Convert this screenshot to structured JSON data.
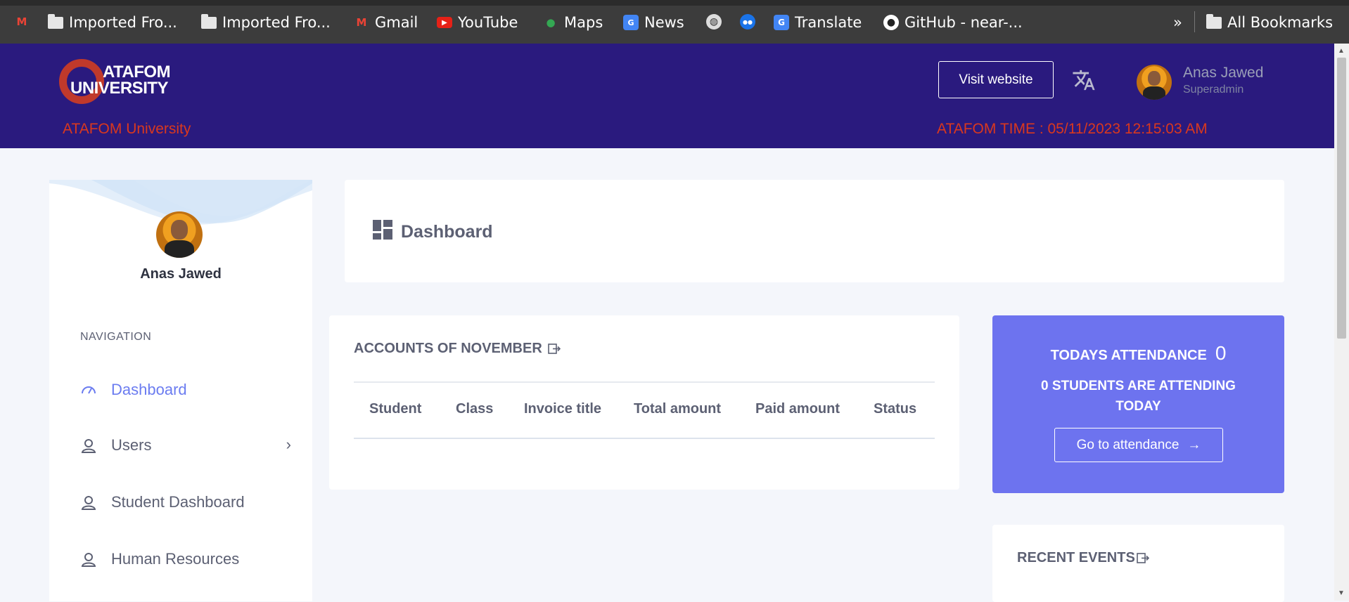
{
  "bookmarks": {
    "items": [
      {
        "label": "",
        "icon": "gmail-icon"
      },
      {
        "label": "Imported Fro...",
        "icon": "folder-icon"
      },
      {
        "label": "Imported Fro...",
        "icon": "folder-icon"
      },
      {
        "label": "Gmail",
        "icon": "gmail-icon"
      },
      {
        "label": "YouTube",
        "icon": "youtube-icon"
      },
      {
        "label": "Maps",
        "icon": "maps-icon"
      },
      {
        "label": "News",
        "icon": "news-icon"
      },
      {
        "label": "",
        "icon": "globe-icon"
      },
      {
        "label": "",
        "icon": "site-icon"
      },
      {
        "label": "Translate",
        "icon": "translate-icon"
      },
      {
        "label": "GitHub - near-...",
        "icon": "github-icon"
      }
    ],
    "overflow": "»",
    "all_bookmarks": "All Bookmarks"
  },
  "header": {
    "logo_line1": "ATAFOM",
    "logo_line2": "UNIVERSITY",
    "university_name": "ATAFOM University",
    "visit_website": "Visit website",
    "user_name": "Anas Jawed",
    "user_role": "Superadmin",
    "time_text": "ATAFOM TIME : 05/11/2023 12:15:03 AM",
    "brand_color": "#2a1a7e",
    "accent_red": "#d9381e"
  },
  "sidebar": {
    "profile_name": "Anas Jawed",
    "nav_title": "NAVIGATION",
    "items": [
      {
        "label": "Dashboard",
        "icon": "gauge-icon",
        "active": true
      },
      {
        "label": "Users",
        "icon": "user-icon",
        "has_submenu": true
      },
      {
        "label": "Student Dashboard",
        "icon": "user-icon"
      },
      {
        "label": "Human Resources",
        "icon": "user-icon"
      }
    ]
  },
  "main": {
    "page_title": "Dashboard",
    "accounts": {
      "title": "ACCOUNTS OF NOVEMBER",
      "columns": [
        "Student",
        "Class",
        "Invoice title",
        "Total amount",
        "Paid amount",
        "Status"
      ],
      "rows": []
    },
    "attendance": {
      "title": "TODAYS ATTENDANCE",
      "count": "0",
      "subtitle": "0 STUDENTS ARE ATTENDING TODAY",
      "button": "Go to attendance",
      "color": "#6d73ef"
    },
    "events": {
      "title": "RECENT EVENTS"
    }
  }
}
